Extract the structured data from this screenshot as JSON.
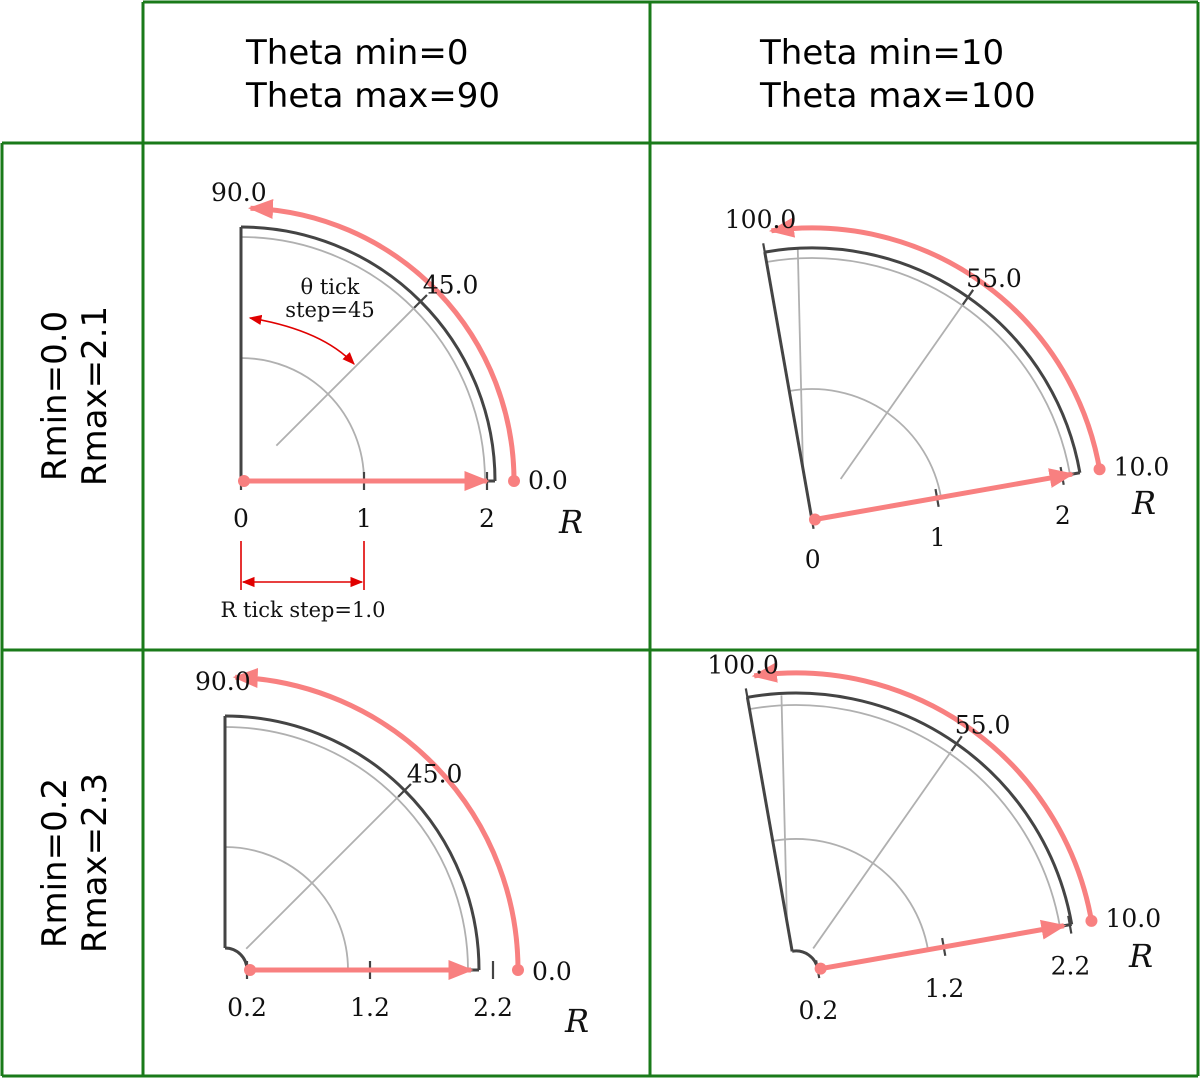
{
  "colors": {
    "grid_border": "#1a7a1a",
    "axis_dark": "#444444",
    "grid_light": "#b0b0b0",
    "arrow_pink": "#f88080",
    "annotation_red": "#e00000"
  },
  "columns": [
    {
      "line1": "Theta min=0",
      "line2": "Theta max=90"
    },
    {
      "line1": "Theta min=10",
      "line2": "Theta max=100"
    }
  ],
  "rows": [
    {
      "line1": "Rmin=0.0",
      "line2": "Rmax=2.1"
    },
    {
      "line1": "Rmin=0.2",
      "line2": "Rmax=2.3"
    }
  ],
  "panels": [
    {
      "theta_labels": [
        "90.0",
        "45.0",
        "0.0"
      ],
      "r_ticks": [
        "0",
        "1",
        "2"
      ],
      "r_axis_label": "R"
    },
    {
      "theta_labels": [
        "100.0",
        "55.0",
        "10.0"
      ],
      "r_ticks": [
        "0",
        "1",
        "2"
      ],
      "r_axis_label": "R"
    },
    {
      "theta_labels": [
        "90.0",
        "45.0",
        "0.0"
      ],
      "r_ticks": [
        "0.2",
        "1.2",
        "2.2"
      ],
      "r_axis_label": "R"
    },
    {
      "theta_labels": [
        "100.0",
        "55.0",
        "10.0"
      ],
      "r_ticks": [
        "0.2",
        "1.2",
        "2.2"
      ],
      "r_axis_label": "R"
    }
  ],
  "annotations": {
    "theta_step_line1": "θ tick",
    "theta_step_line2": "step=45",
    "r_step": "R tick step=1.0"
  }
}
